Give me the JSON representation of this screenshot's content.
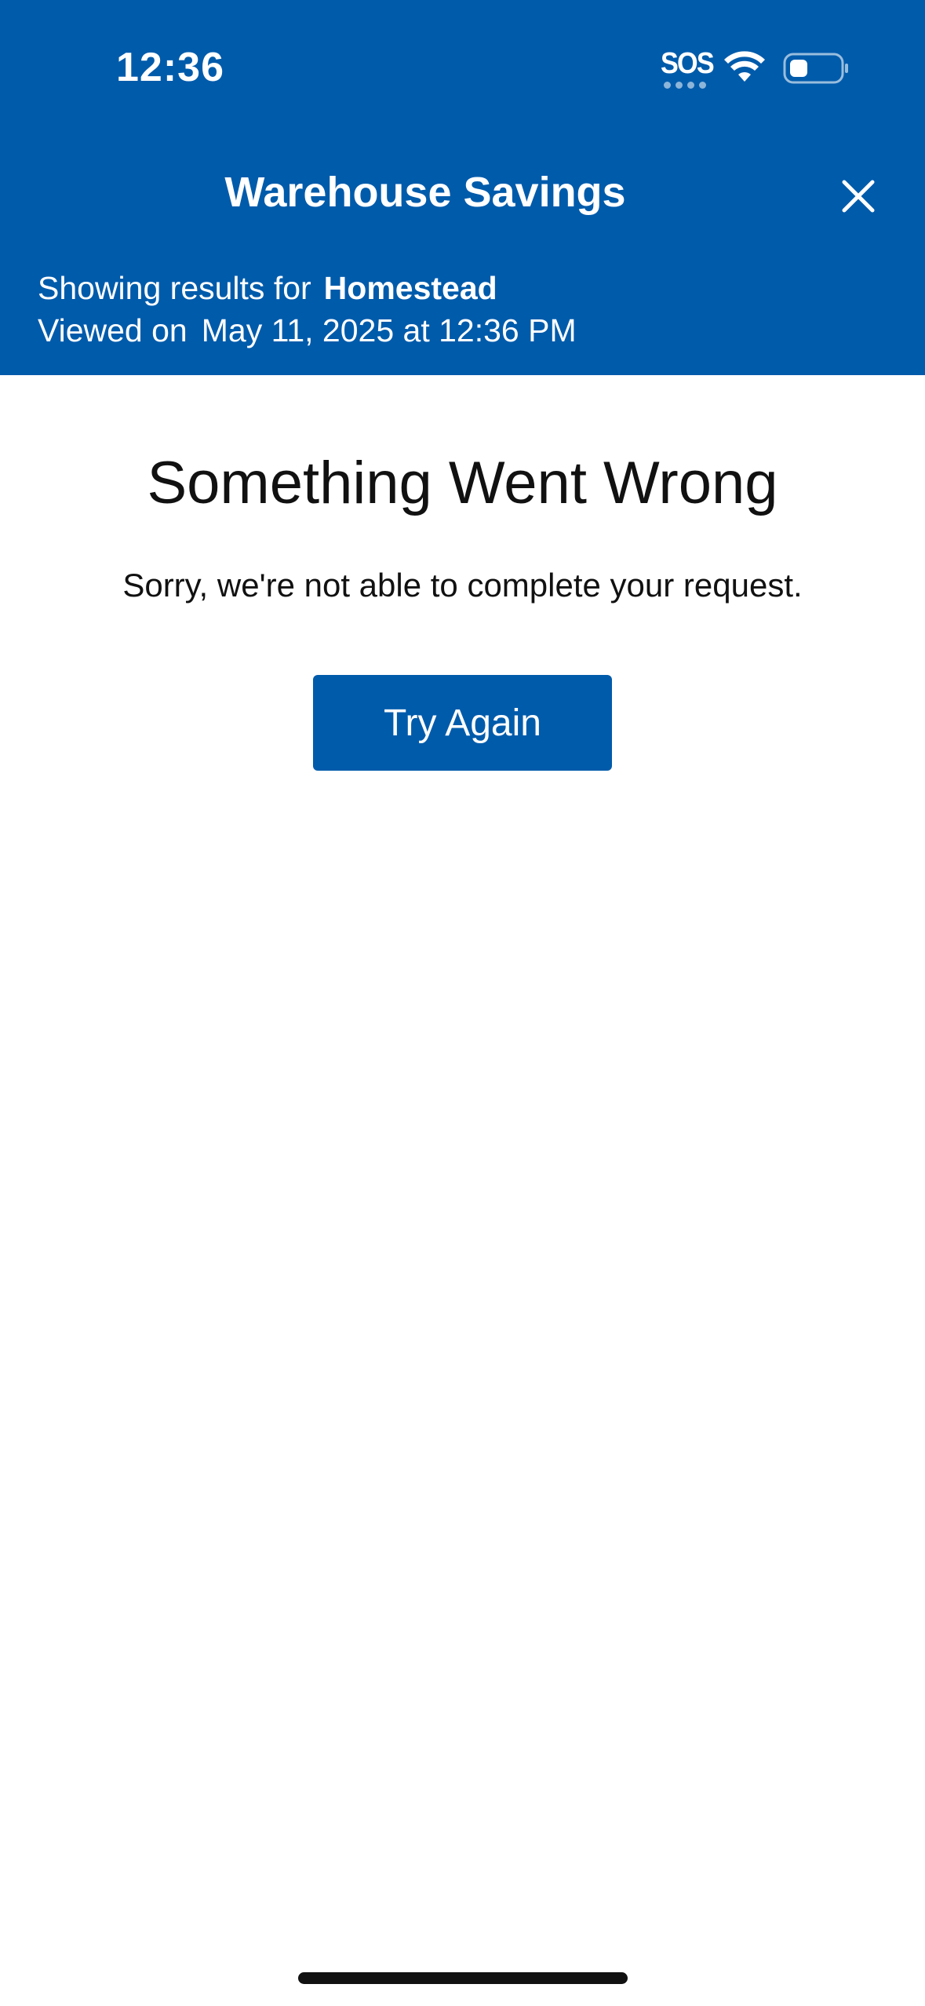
{
  "status_bar": {
    "time": "12:36",
    "sos": "SOS",
    "wifi_icon": "wifi-icon",
    "battery_icon": "battery-low-icon"
  },
  "header": {
    "title": "Warehouse Savings",
    "close_icon": "close-icon",
    "results_label": "Showing results for",
    "location": "Homestead",
    "viewed_label": "Viewed on",
    "viewed_datetime": "May 11, 2025 at 12:36 PM",
    "background_color": "#005bab"
  },
  "error": {
    "title": "Something Went Wrong",
    "message": "Sorry, we're not able to complete your request.",
    "retry_label": "Try Again"
  }
}
